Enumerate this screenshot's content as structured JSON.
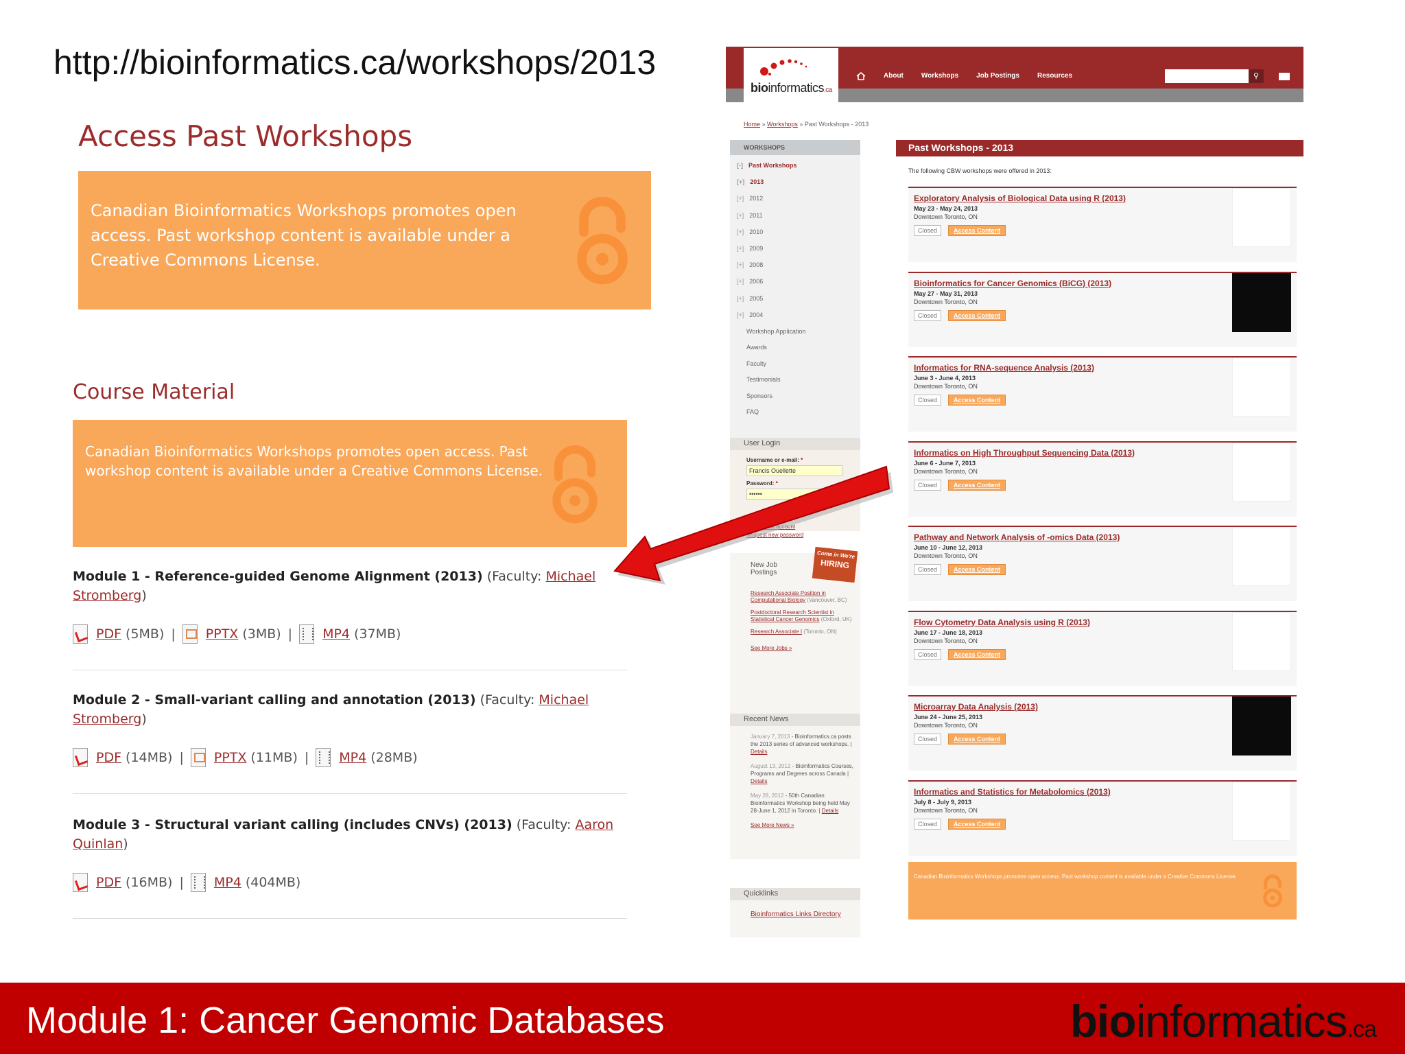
{
  "slide": {
    "url_heading": "http://bioinformatics.ca/workshops/2013",
    "footer_title": "Module 1: Cancer Genomic Databases",
    "footer_brand_bold": "bio",
    "footer_brand_rest": "informatics",
    "footer_brand_suffix": ".ca"
  },
  "left_panel": {
    "access_heading": "Access Past Workshops",
    "access_text": "Canadian Bioinformatics Workshops promotes open access. Past workshop content is available under a Creative Commons License.",
    "course_heading": "Course Material",
    "course_text": "Canadian Bioinformatics Workshops promotes open access. Past workshop content is available under a Creative Commons License.",
    "modules": [
      {
        "title": "Module 1 - Reference-guided Genome Alignment (2013)",
        "faculty_label": "(Faculty: ",
        "faculty_first": "Michael",
        "faculty_last": "Stromberg",
        "faculty_close": ")",
        "files": [
          {
            "type": "PDF",
            "size": "(5MB)"
          },
          {
            "type": "PPTX",
            "size": "(3MB)"
          },
          {
            "type": "MP4",
            "size": "(37MB)"
          }
        ]
      },
      {
        "title": "Module 2 - Small-variant calling and annotation (2013)",
        "faculty_label": "(Faculty: ",
        "faculty_first": "Michael",
        "faculty_last": "Stromberg",
        "faculty_close": ")",
        "files": [
          {
            "type": "PDF",
            "size": "(14MB)"
          },
          {
            "type": "PPTX",
            "size": "(11MB)"
          },
          {
            "type": "MP4",
            "size": "(28MB)"
          }
        ]
      },
      {
        "title": "Module 3 - Structural variant calling (includes CNVs) (2013)",
        "faculty_label": "(Faculty: ",
        "faculty_first": "Aaron",
        "faculty_last": "Quinlan",
        "faculty_close": ")",
        "files": [
          {
            "type": "PDF",
            "size": "(16MB)"
          },
          {
            "type": "MP4",
            "size": "(404MB)"
          }
        ]
      }
    ],
    "separator": "|"
  },
  "site": {
    "logo_bold": "bio",
    "logo_rest": "informatics",
    "logo_suffix": ".ca",
    "nav": [
      "About",
      "Workshops",
      "Job Postings",
      "Resources"
    ],
    "breadcrumb": {
      "home": "Home",
      "workshops": "Workshops",
      "current": "» Past Workshops - 2013"
    },
    "sidebar": {
      "heading": "WORKSHOPS",
      "past": "Past Workshops",
      "years": [
        "2013",
        "2012",
        "2011",
        "2010",
        "2009",
        "2008",
        "2006",
        "2005",
        "2004"
      ],
      "year_marker": "[+]",
      "past_marker": "[-]",
      "links": [
        "Workshop Application",
        "Awards",
        "Faculty",
        "Testimonials",
        "Sponsors",
        "FAQ"
      ]
    },
    "login": {
      "heading": "User Login",
      "username_label": "Username or e-mail:",
      "username_value": "Francis Ouellette",
      "password_label": "Password:",
      "password_value": "••••••",
      "required": "*",
      "create": "Create new account",
      "request": "Request new password"
    },
    "jobs": {
      "heading_1": "New Job",
      "heading_2": "Postings",
      "hiring_top": "Come in We're",
      "hiring_main": "HIRING",
      "items": [
        {
          "link": "Research Associate Position in Computational Biology",
          "loc": "(Vancouver, BC)"
        },
        {
          "link": "Postdoctoral Research Scientist in Statistical Cancer Genomics",
          "loc": "(Oxford, UK)"
        },
        {
          "link": "Research Associate I",
          "loc": "(Toronto, ON)"
        }
      ],
      "more": "See More Jobs »"
    },
    "news": {
      "heading": "Recent News",
      "items": [
        {
          "date": "January 7, 2013",
          "text": " - Bioinformatics.ca posts the 2013 series of advanced workshops. | ",
          "link": "Details"
        },
        {
          "date": "August 13, 2012",
          "text": " - Bioinformatics Courses, Programs and Degrees across Canada | ",
          "link": "Details"
        },
        {
          "date": "May 28, 2012",
          "text": " - 50th Canadian Bioinformatics Workshop being held May 28-June 1, 2012 in Toronto. | ",
          "link": "Details"
        }
      ],
      "more": "See More News »"
    },
    "quicklinks": {
      "heading": "Quicklinks",
      "link": "Bioinformatics Links Directory"
    },
    "content": {
      "title": "Past Workshops - 2013",
      "intro": "The following CBW workshops were offered in 2013:",
      "closed_label": "Closed",
      "access_label": "Access Content",
      "workshops": [
        {
          "title": "Exploratory Analysis of Biological Data using R (2013)",
          "dates": "May 23 - May 24, 2013",
          "location": "Downtown Toronto, ON",
          "thumb": "light"
        },
        {
          "title": "Bioinformatics for Cancer Genomics (BiCG) (2013)",
          "dates": "May 27 - May 31, 2013",
          "location": "Downtown Toronto, ON",
          "thumb": "dark"
        },
        {
          "title": "Informatics for RNA-sequence Analysis (2013)",
          "dates": "June 3 - June 4, 2013",
          "location": "Downtown Toronto, ON",
          "thumb": "light"
        },
        {
          "title": "Informatics on High Throughput Sequencing Data (2013)",
          "dates": "June 6 - June 7, 2013",
          "location": "Downtown Toronto, ON",
          "thumb": "light"
        },
        {
          "title": "Pathway and Network Analysis of -omics Data (2013)",
          "dates": "June 10 - June 12, 2013",
          "location": "Downtown Toronto, ON",
          "thumb": "light"
        },
        {
          "title": "Flow Cytometry Data Analysis using R (2013)",
          "dates": "June 17 - June 18, 2013",
          "location": "Downtown Toronto, ON",
          "thumb": "light"
        },
        {
          "title": "Microarray Data Analysis (2013)",
          "dates": "June 24 - June 25, 2013",
          "location": "Downtown Toronto, ON",
          "thumb": "dark"
        },
        {
          "title": "Informatics and Statistics for Metabolomics (2013)",
          "dates": "July 8 - July 9, 2013",
          "location": "Downtown Toronto, ON",
          "thumb": "light"
        }
      ],
      "oa_text": "Canadian Bioinformatics Workshops promotes open access. Past workshop content is available under a Creative Commons License."
    }
  },
  "colors": {
    "brand_red": "#9a2a2a",
    "footer_red": "#c00000",
    "oa_orange": "#f9a759",
    "arrow_red": "#e01010"
  },
  "icons": [
    "open-access-icon",
    "pdf-file-icon",
    "pptx-file-icon",
    "mp4-file-icon",
    "home-icon",
    "search-icon",
    "mail-icon",
    "arrow-pointer"
  ]
}
